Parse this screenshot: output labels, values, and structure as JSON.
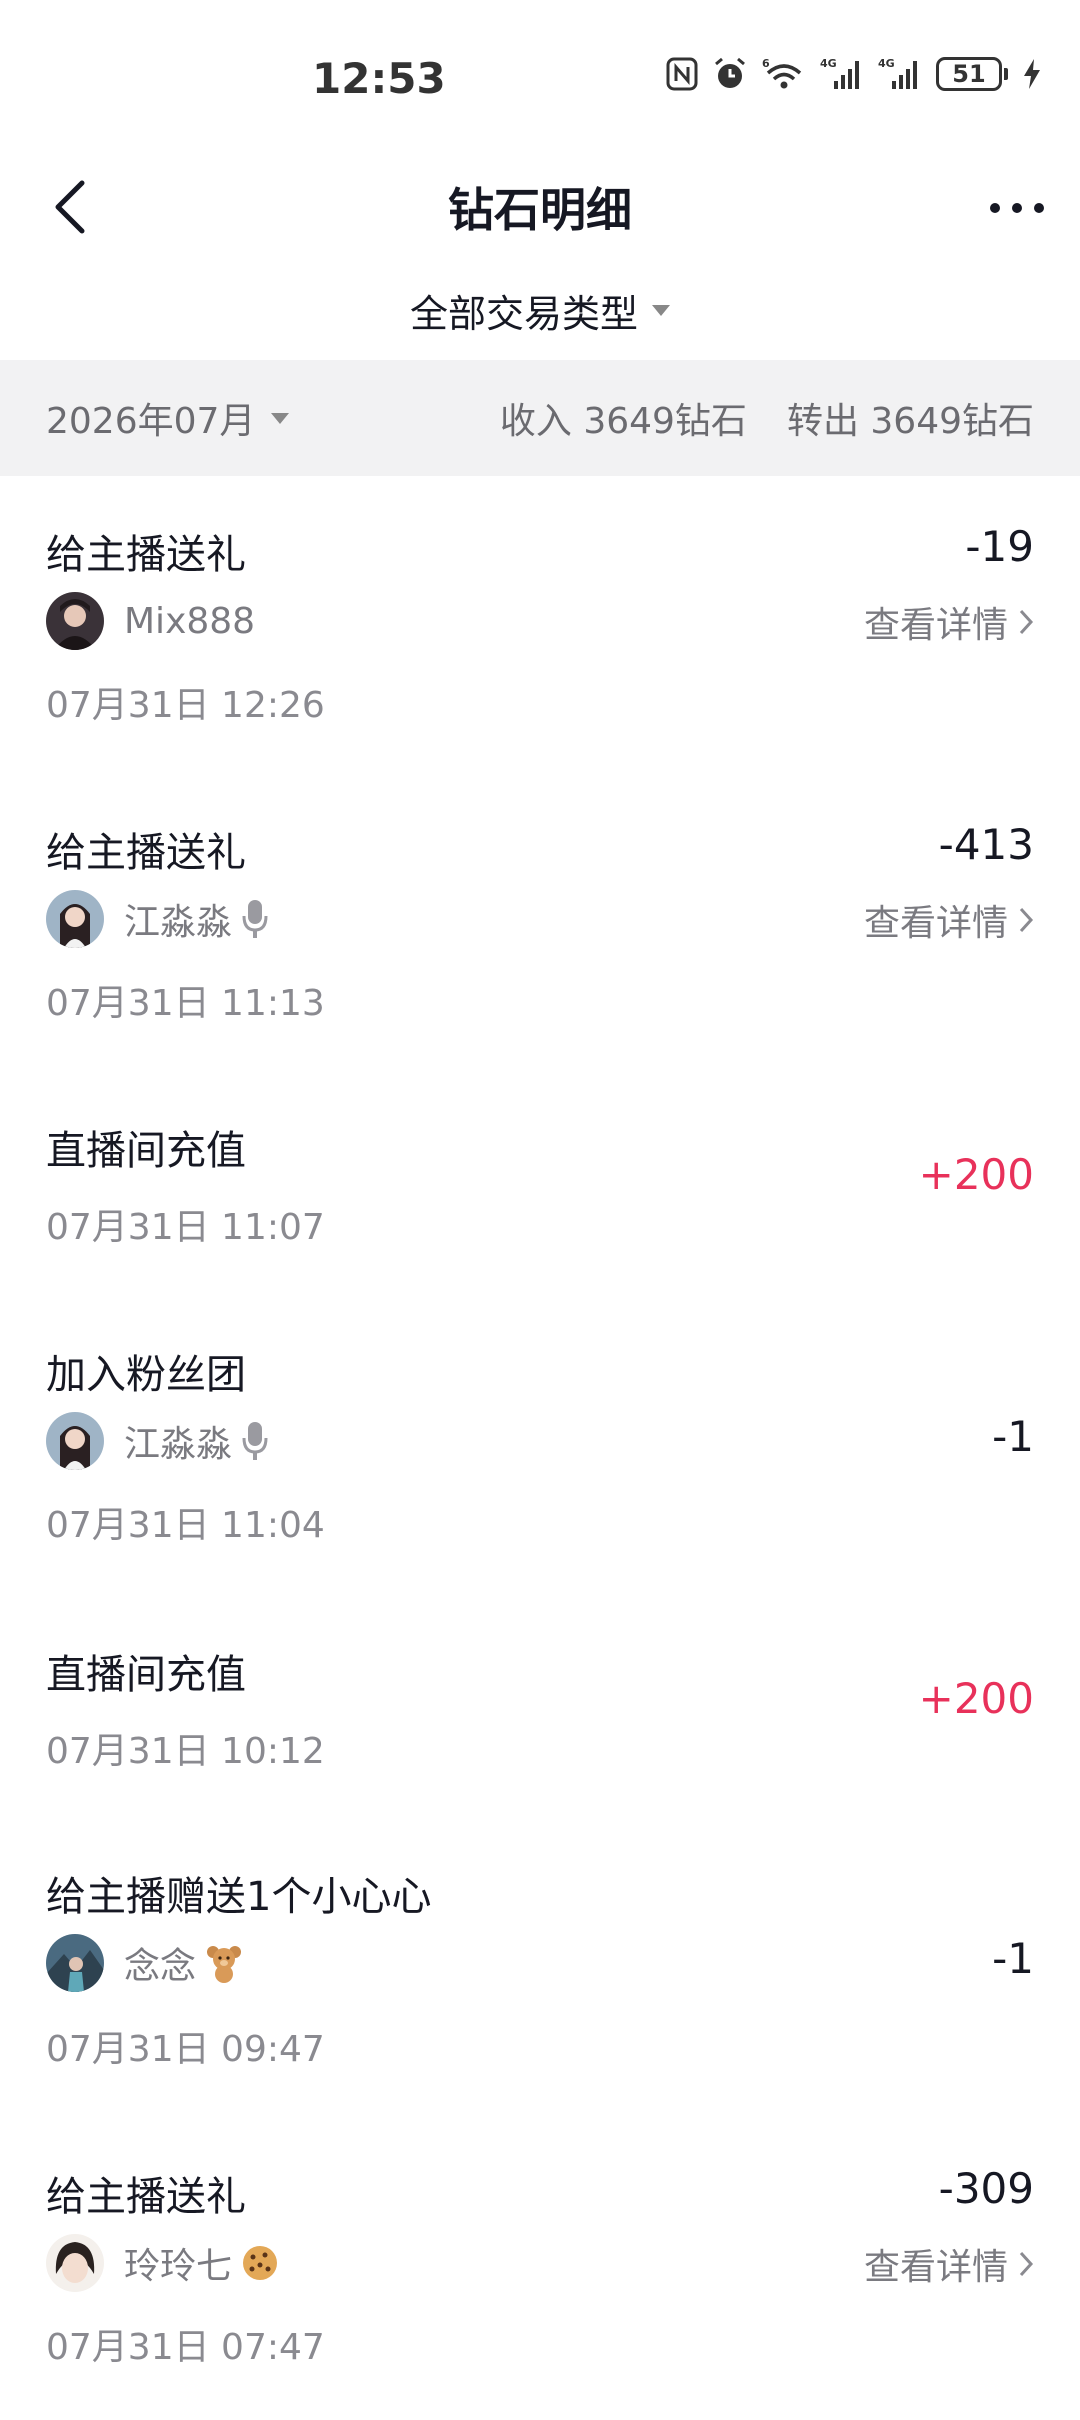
{
  "status_bar": {
    "time": "12:53",
    "battery": "51"
  },
  "header": {
    "title": "钻石明细"
  },
  "filter": {
    "label": "全部交易类型"
  },
  "summary": {
    "month": "2026年07月",
    "income": "收入 3649钻石",
    "transfer_out": "转出 3649钻石"
  },
  "detail_label": "查看详情",
  "transactions": [
    {
      "title": "给主播送礼",
      "user": "Mix888",
      "time": "07月31日 12:26",
      "amount": "-19"
    },
    {
      "title": "给主播送礼",
      "user": "江淼淼",
      "time": "07月31日 11:13",
      "amount": "-413"
    },
    {
      "title": "直播间充值",
      "time": "07月31日 11:07",
      "amount": "+200"
    },
    {
      "title": "加入粉丝团",
      "user": "江淼淼",
      "time": "07月31日 11:04",
      "amount": "-1"
    },
    {
      "title": "直播间充值",
      "time": "07月31日 10:12",
      "amount": "+200"
    },
    {
      "title": "给主播赠送1个小心心",
      "user": "念念",
      "time": "07月31日 09:47",
      "amount": "-1"
    },
    {
      "title": "给主播送礼",
      "user": "玲玲七",
      "time": "07月31日 07:47",
      "amount": "-309"
    }
  ],
  "colors": {
    "positive": "#e8315a",
    "text": "#161823",
    "secondary": "#7a7a80",
    "summary_bg": "#f2f2f3"
  }
}
